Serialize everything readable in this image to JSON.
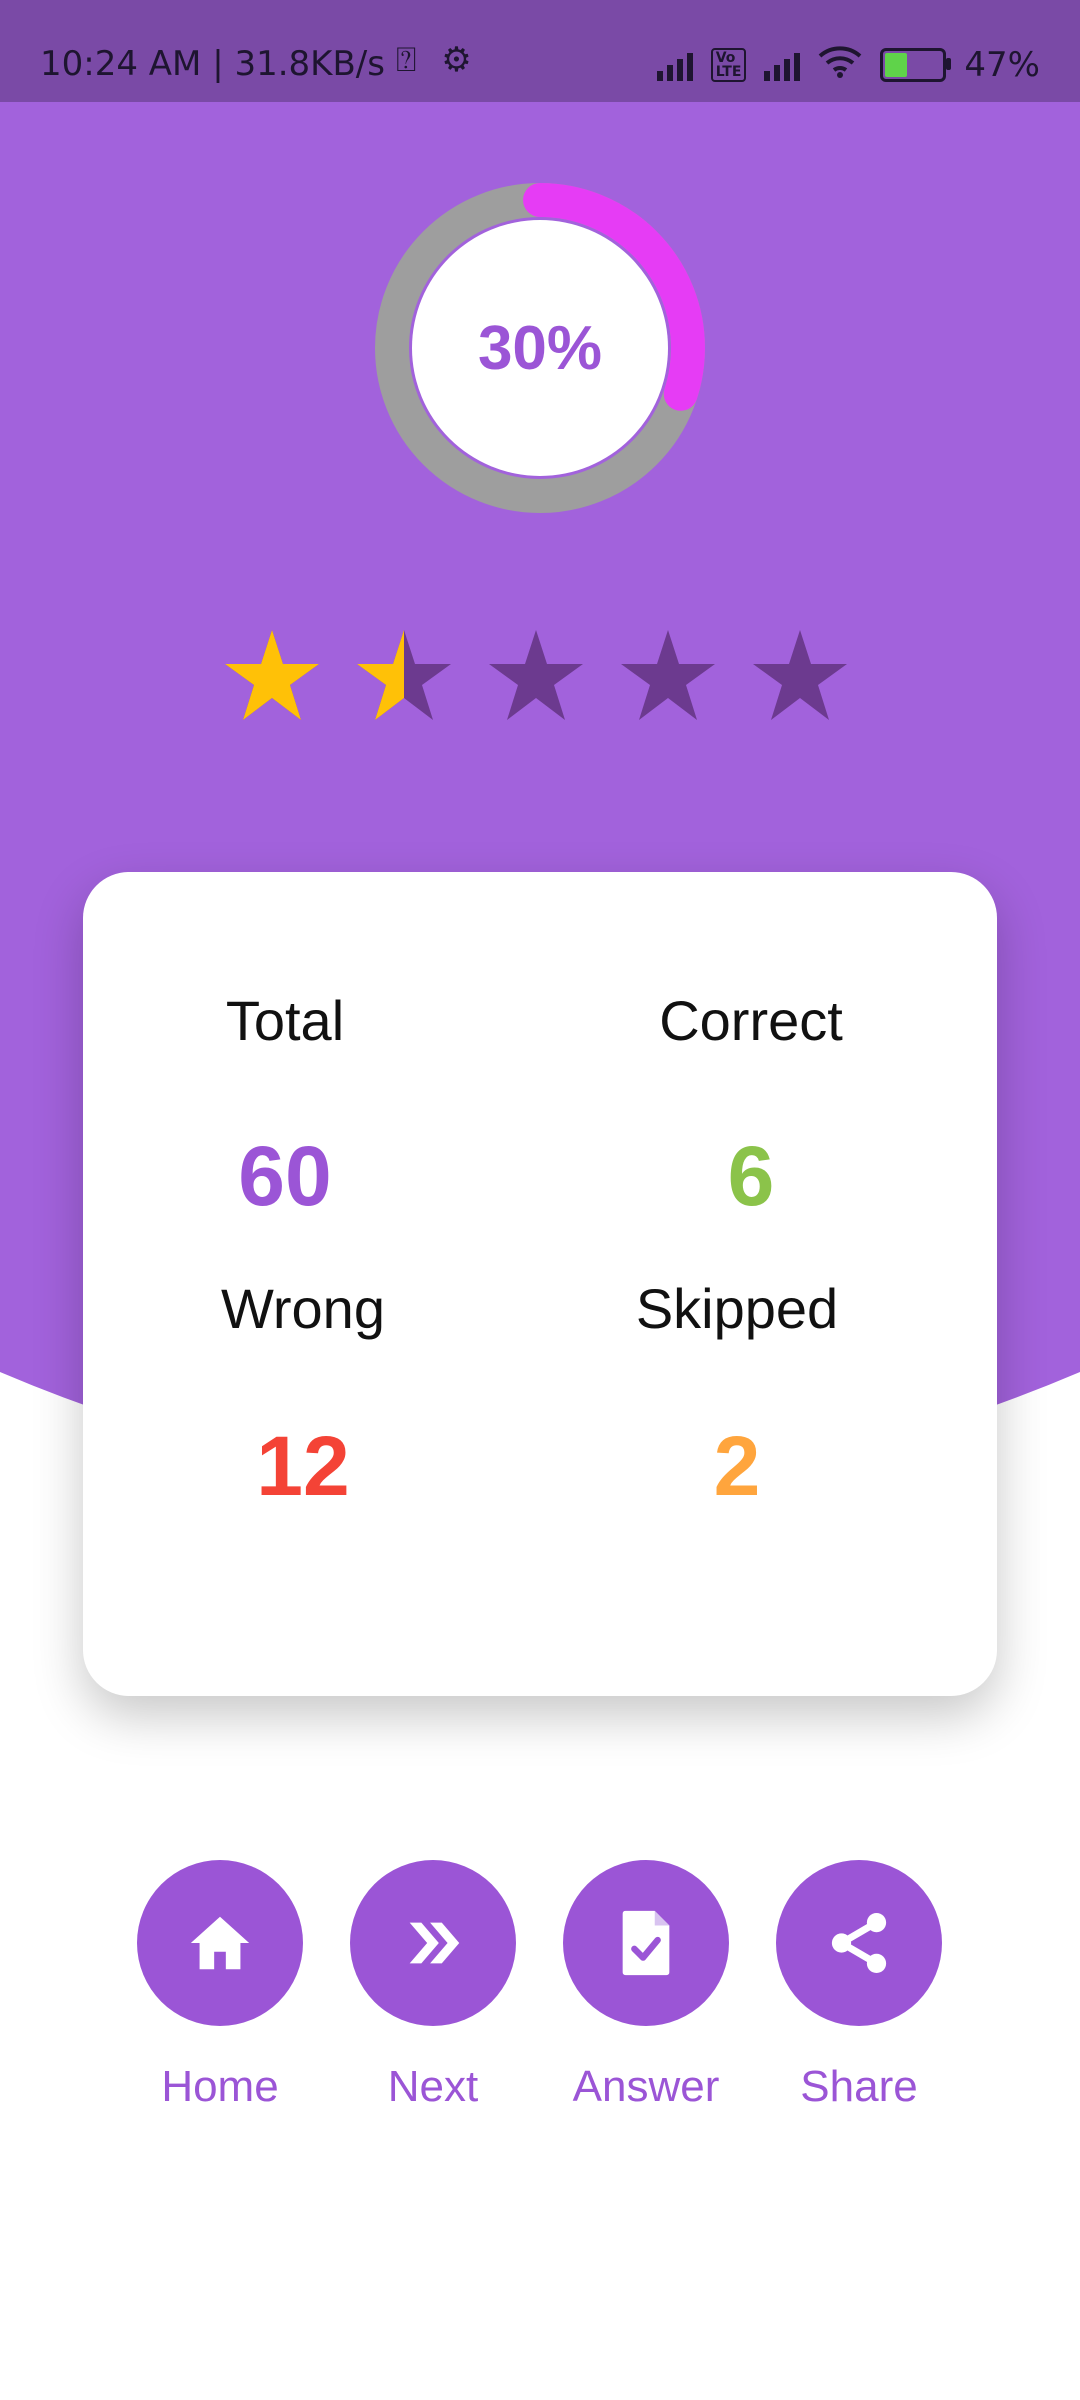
{
  "status_bar": {
    "time": "10:24 AM | 31.8KB/s",
    "battery": "47%"
  },
  "score": {
    "percent_label": "30%",
    "progress_fraction": 0.3,
    "ring_fill_color": "#e63cf5",
    "ring_track_color": "#9e9e9e"
  },
  "rating": {
    "max_stars": 5,
    "value": 1.5,
    "filled_color": "#ffc107",
    "empty_color": "#6c3a8f"
  },
  "stats": {
    "total": {
      "label": "Total",
      "value": "60",
      "color": "#9b55d6"
    },
    "correct": {
      "label": "Correct",
      "value": "6",
      "color": "#8bc34a"
    },
    "wrong": {
      "label": "Wrong",
      "value": "12",
      "color": "#f44336"
    },
    "skipped": {
      "label": "Skipped",
      "value": "2",
      "color": "#ffa53d"
    }
  },
  "actions": [
    {
      "label": "Home",
      "icon": "home-icon"
    },
    {
      "label": "Next",
      "icon": "double-chevron-right-icon"
    },
    {
      "label": "Answer",
      "icon": "answer-document-icon"
    },
    {
      "label": "Share",
      "icon": "share-icon"
    }
  ],
  "theme": {
    "primary": "#a262dc",
    "accent": "#9b55d6",
    "status_bar": "#7a4aa6"
  }
}
